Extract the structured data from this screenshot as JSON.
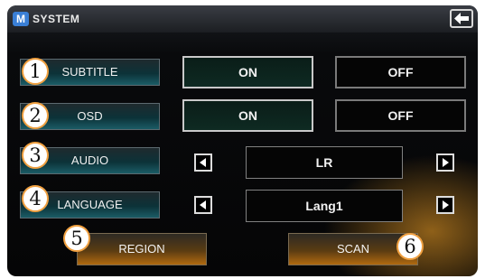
{
  "header": {
    "app_icon_label": "M",
    "title": "SYSTEM",
    "back_icon": "back-arrow-icon"
  },
  "rows": {
    "subtitle": {
      "label": "SUBTITLE",
      "on": "ON",
      "off": "OFF",
      "selected": "ON"
    },
    "osd": {
      "label": "OSD",
      "on": "ON",
      "off": "OFF",
      "selected": "ON"
    },
    "audio": {
      "label": "AUDIO",
      "value": "LR"
    },
    "language": {
      "label": "LANGUAGE",
      "value": "Lang1"
    }
  },
  "buttons": {
    "region": "REGION",
    "scan": "SCAN"
  },
  "callouts": [
    "1",
    "2",
    "3",
    "4",
    "5",
    "6"
  ],
  "colors": {
    "accent_teal": "#1b5c66",
    "accent_orange": "#b06a10",
    "callout_border": "#f0a040",
    "app_icon_blue": "#3a7fd6"
  }
}
